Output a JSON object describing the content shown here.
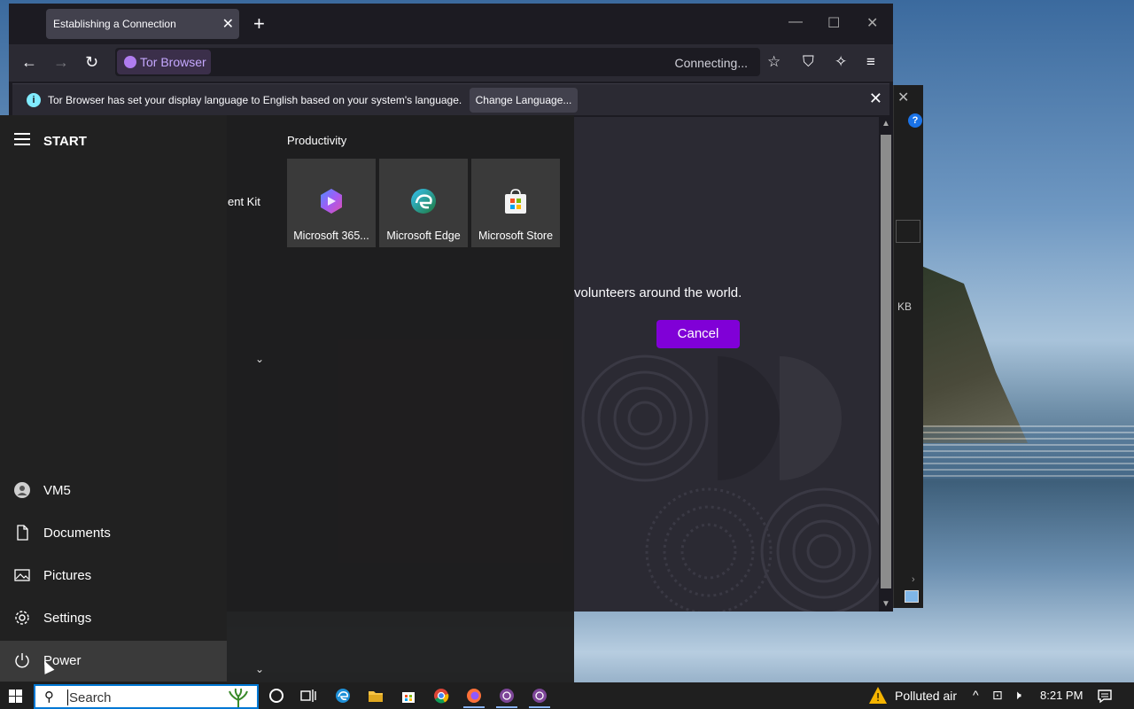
{
  "browser": {
    "tab_title": "Establishing a Connection",
    "url_chip": "Tor Browser",
    "status": "Connecting...",
    "infobar_text": "Tor Browser has set your display language to English based on your system's language.",
    "change_language_label": "Change Language...",
    "content_text": "volunteers around the world.",
    "cancel_label": "Cancel"
  },
  "start_menu": {
    "title": "START",
    "partial_text": "ent Kit",
    "group_title": "Productivity",
    "tiles": [
      {
        "label": "Microsoft 365...",
        "icon": "microsoft-365-icon"
      },
      {
        "label": "Microsoft Edge",
        "icon": "edge-icon"
      },
      {
        "label": "Microsoft Store",
        "icon": "store-icon"
      }
    ],
    "items": [
      {
        "label": "VM5",
        "icon": "user-icon"
      },
      {
        "label": "Documents",
        "icon": "document-icon"
      },
      {
        "label": "Pictures",
        "icon": "pictures-icon"
      },
      {
        "label": "Settings",
        "icon": "gear-icon"
      },
      {
        "label": "Power",
        "icon": "power-icon"
      }
    ]
  },
  "background_dialog": {
    "size_text": "KB"
  },
  "taskbar": {
    "search_placeholder": "Search",
    "weather_text": "Polluted air",
    "time": "8:21 PM"
  },
  "colors": {
    "tor_purple": "#8000d7",
    "firefox_dark": "#1c1b22",
    "taskbar": "#1f1f1f"
  }
}
